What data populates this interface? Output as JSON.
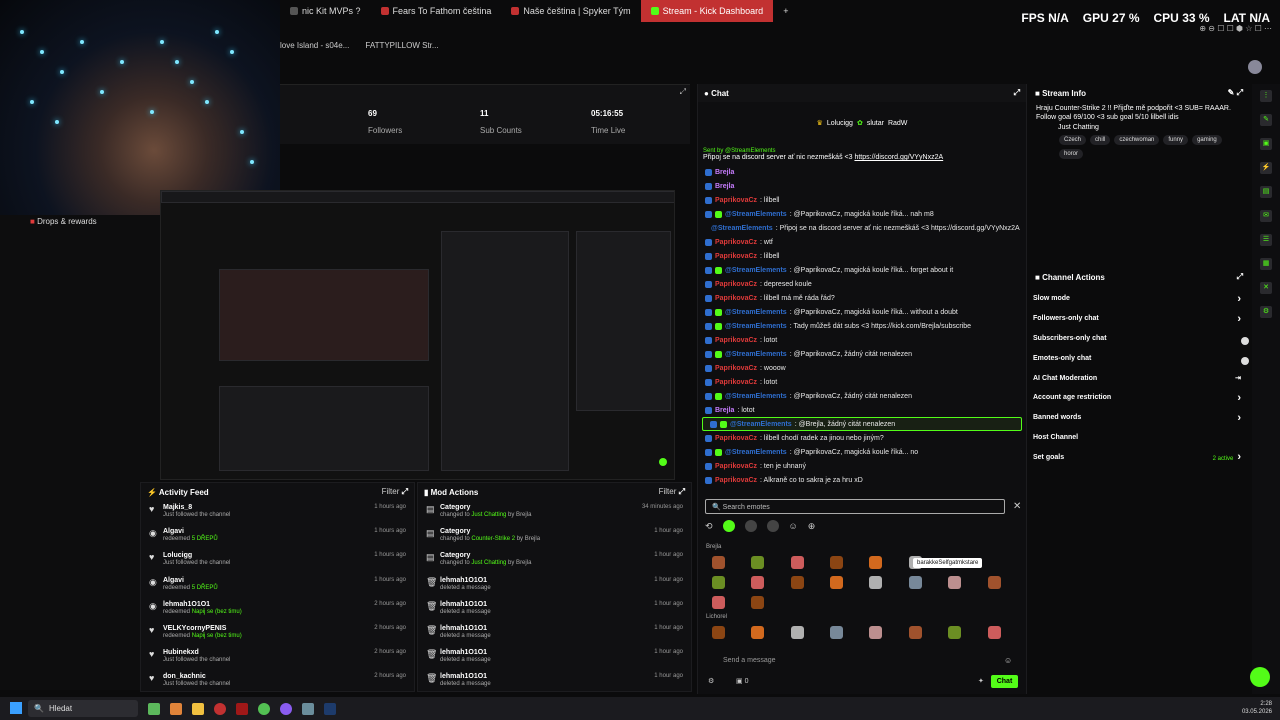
{
  "tabs": [
    {
      "label": "nic Kit MVPs ?",
      "color": "#555"
    },
    {
      "label": "Fears To Fathom čeština",
      "color": "#c23131"
    },
    {
      "label": "Naše čeština | Spyker Tým",
      "color": "#c23131"
    },
    {
      "label": "Stream - Kick Dashboard",
      "color": "#53fc18",
      "active": true
    }
  ],
  "new_tab_symbol": "+",
  "bookmarks": [
    "love Island - s04e...",
    "FATTYPILLOW Str..."
  ],
  "perf": {
    "fps_label": "FPS",
    "fps": "N/A",
    "gpu_label": "GPU",
    "gpu": "27 %",
    "cpu_label": "CPU",
    "cpu": "33 %",
    "lat_label": "LAT",
    "lat": "N/A"
  },
  "stats": [
    {
      "value": "69",
      "label": "Followers"
    },
    {
      "value": "11",
      "label": "Sub Counts"
    },
    {
      "value": "05:16:55",
      "label": "Time Live"
    }
  ],
  "drops_label": "Drops & rewards",
  "activity": {
    "title": "Activity Feed",
    "filter": "Filter",
    "rows": [
      {
        "icon": "heart-icon",
        "name": "Majkis_8",
        "pre": "Just followed the channel",
        "green": "",
        "time": "1 hours ago"
      },
      {
        "icon": "coin-icon",
        "name": "Algavi",
        "pre": "redeemed ",
        "green": "5 DŘEPŮ",
        "time": "1 hours ago"
      },
      {
        "icon": "heart-icon",
        "name": "Lolucigg",
        "pre": "Just followed the channel",
        "green": "",
        "time": "1 hours ago"
      },
      {
        "icon": "coin-icon",
        "name": "Algavi",
        "pre": "redeemed ",
        "green": "5 DŘEPŮ",
        "time": "1 hours ago"
      },
      {
        "icon": "coin-icon",
        "name": "lehmah1O1O1",
        "pre": "redeemed ",
        "green": "Napij se (bez timu)",
        "time": "2 hours ago"
      },
      {
        "icon": "heart-icon",
        "name": "VELKYcornyPENIS",
        "pre": "redeemed ",
        "green": "Napij se (bez timu)",
        "time": "2 hours ago"
      },
      {
        "icon": "heart-icon",
        "name": "Hubinekxd",
        "pre": "Just followed the channel",
        "green": "",
        "time": "2 hours ago"
      },
      {
        "icon": "heart-icon",
        "name": "don_kachnic",
        "pre": "Just followed the channel",
        "green": "",
        "time": "2 hours ago"
      }
    ]
  },
  "modactions": {
    "title": "Mod Actions",
    "filter": "Filter",
    "rows": [
      {
        "icon": "category-icon",
        "name": "Category",
        "pre": "changed to ",
        "green": "Just Chatting",
        "post": " by Brejla",
        "time": "34 minutes ago"
      },
      {
        "icon": "category-icon",
        "name": "Category",
        "pre": "changed to ",
        "green": "Counter-Strike 2",
        "post": " by Brejla",
        "time": "1 hour ago"
      },
      {
        "icon": "category-icon",
        "name": "Category",
        "pre": "changed to ",
        "green": "Just Chatting",
        "post": " by Brejla",
        "time": "1 hour ago"
      },
      {
        "icon": "trash-icon",
        "name": "lehmah1O1O1",
        "pre": "deleted a message",
        "green": "",
        "post": "",
        "time": "1 hour ago"
      },
      {
        "icon": "trash-icon",
        "name": "lehmah1O1O1",
        "pre": "deleted a message",
        "green": "",
        "post": "",
        "time": "1 hour ago"
      },
      {
        "icon": "trash-icon",
        "name": "lehmah1O1O1",
        "pre": "deleted a message",
        "green": "",
        "post": "",
        "time": "1 hour ago"
      },
      {
        "icon": "trash-icon",
        "name": "lehmah1O1O1",
        "pre": "deleted a message",
        "green": "",
        "post": "",
        "time": "1 hour ago"
      },
      {
        "icon": "trash-icon",
        "name": "lehmah1O1O1",
        "pre": "deleted a message",
        "green": "",
        "post": "",
        "time": "1 hour ago"
      }
    ]
  },
  "chat": {
    "title": "Chat",
    "top_users": [
      "Lolucigg",
      "slutar",
      "RadW"
    ],
    "pinned_by": "Sent by @StreamElements",
    "pinned_text": "Připoj se na discord server ať nic nezmeškáš <3 ",
    "pinned_link": "https://discord.gg/VYyNxz2A",
    "messages": [
      {
        "user": "Brejla",
        "ucolor": "#c77dff",
        "text": ""
      },
      {
        "user": "Brejla",
        "ucolor": "#c77dff",
        "text": ""
      },
      {
        "user": "PaprikovaCz",
        "ucolor": "#e03a3a",
        "text": ": lilbell"
      },
      {
        "user": "@StreamElements",
        "ucolor": "#2f6ecf",
        "text": ": @PaprikovaCz, magická koule říká... nah m8"
      },
      {
        "user": "@StreamElements",
        "ucolor": "#2f6ecf",
        "text": ": Připoj se na discord server ať nic nezmeškáš <3 https://discord.gg/VYyNxz2A"
      },
      {
        "user": "PaprikovaCz",
        "ucolor": "#e03a3a",
        "text": ": wtf"
      },
      {
        "user": "PaprikovaCz",
        "ucolor": "#e03a3a",
        "text": ": lilbell"
      },
      {
        "user": "@StreamElements",
        "ucolor": "#2f6ecf",
        "text": ": @PaprikovaCz, magická koule říká... forget about it"
      },
      {
        "user": "PaprikovaCz",
        "ucolor": "#e03a3a",
        "text": ": depresed koule"
      },
      {
        "user": "PaprikovaCz",
        "ucolor": "#e03a3a",
        "text": ": lilbell má mě ráda řád?"
      },
      {
        "user": "@StreamElements",
        "ucolor": "#2f6ecf",
        "text": ": @PaprikovaCz, magická koule říká... without a doubt"
      },
      {
        "user": "@StreamElements",
        "ucolor": "#2f6ecf",
        "text": ": Tady můžeš dát subs <3 https://kick.com/Brejla/subscribe"
      },
      {
        "user": "PaprikovaCz",
        "ucolor": "#e03a3a",
        "text": ": lotot"
      },
      {
        "user": "@StreamElements",
        "ucolor": "#2f6ecf",
        "text": ": @PaprikovaCz, žádný citát nenalezen"
      },
      {
        "user": "PaprikovaCz",
        "ucolor": "#e03a3a",
        "text": ": wooow"
      },
      {
        "user": "PaprikovaCz",
        "ucolor": "#e03a3a",
        "text": ": lotot"
      },
      {
        "user": "@StreamElements",
        "ucolor": "#2f6ecf",
        "text": ": @PaprikovaCz, žádný citát nenalezen"
      },
      {
        "user": "Brejla",
        "ucolor": "#c77dff",
        "text": ": lotot"
      },
      {
        "user": "@StreamElements",
        "ucolor": "#2f6ecf",
        "text": ": @Brejla, žádný citát nenalezen",
        "hl": true
      },
      {
        "user": "PaprikovaCz",
        "ucolor": "#e03a3a",
        "text": ": lilbell chodí radek za jinou nebo jiným?"
      },
      {
        "user": "@StreamElements",
        "ucolor": "#2f6ecf",
        "text": ": @PaprikovaCz, magická koule říká... no"
      },
      {
        "user": "PaprikovaCz",
        "ucolor": "#e03a3a",
        "text": ": ten je uhnaný"
      },
      {
        "user": "PaprikovaCz",
        "ucolor": "#e03a3a",
        "text": ": Alkraně co to sakra je za hru xD"
      }
    ],
    "emote_search_placeholder": "Search emotes",
    "emote_section_1": "Brejla",
    "emote_section_2": "Lichorel",
    "tooltip": "barakkeSelfgatmkstare",
    "send_placeholder": "Send a message",
    "chat_button": "Chat",
    "viewer_count": "0"
  },
  "streaminfo": {
    "title": "Stream Info",
    "stream_title": "Hraju Counter-Strike 2 !! Přijďte mě podpořit <3 SUB= RAAAR. Follow goal 69/100 <3 sub goal 5/10 lilbell idis",
    "category": "Just Chatting",
    "tags": [
      "Czech",
      "chill",
      "czechwoman",
      "funny",
      "gaming",
      "horor"
    ]
  },
  "channelactions": {
    "title": "Channel Actions",
    "items": [
      {
        "label": "Slow mode",
        "ctrl": "arrow"
      },
      {
        "label": "Followers-only chat",
        "ctrl": "arrow"
      },
      {
        "label": "Subscribers-only chat",
        "ctrl": "toggle"
      },
      {
        "label": "Emotes-only chat",
        "ctrl": "toggle"
      },
      {
        "label": "AI Chat Moderation",
        "ctrl": "ext"
      },
      {
        "label": "Account age restriction",
        "ctrl": "arrow"
      },
      {
        "label": "Banned words",
        "ctrl": "arrow"
      },
      {
        "label": "Host Channel",
        "ctrl": "none"
      },
      {
        "label": "Set goals",
        "ctrl": "arrow",
        "extra": "2 active"
      }
    ]
  },
  "taskbar": {
    "search": "Hledat",
    "time": "2:28",
    "date": "03.05.2026"
  }
}
